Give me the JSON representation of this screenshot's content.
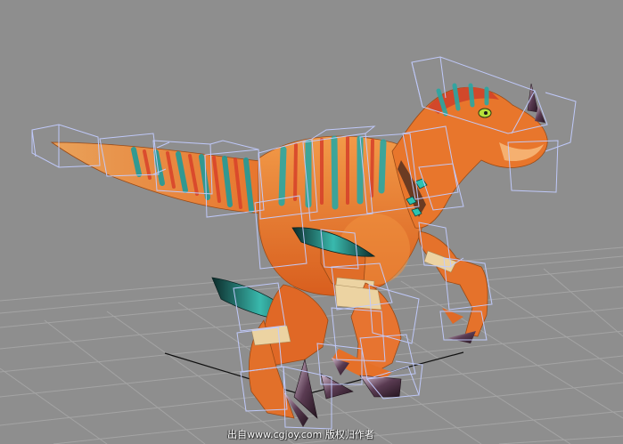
{
  "viewport": {
    "background": "#8e8e8e",
    "grid_color": "#a6a6a6",
    "axis_color": "#000000",
    "bone_box_color": "#b9c3ff",
    "model": "raptor-dinosaur-rig",
    "watermark": "出自www.cgjoy.com 版权归作者"
  },
  "colors": {
    "skin_orange": "#e8742a",
    "skin_light": "#f3a24d",
    "stripe_teal": "#2ea3a0",
    "claw_dark": "#3a2436",
    "wrap_tan": "#e9d3a6"
  }
}
